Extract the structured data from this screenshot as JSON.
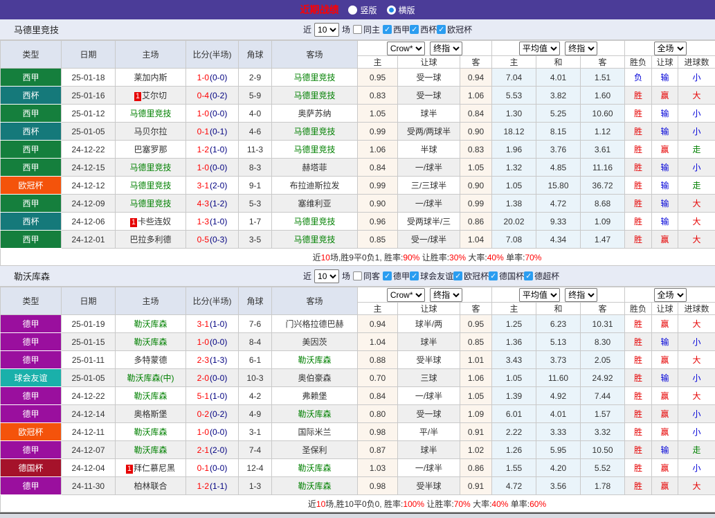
{
  "topbar": {
    "title": "近期战绩",
    "radio_vertical": "竖版",
    "radio_horizontal": "横版"
  },
  "table_header": {
    "col_type": "类型",
    "col_date": "日期",
    "col_home": "主场",
    "col_score": "比分(半场)",
    "col_corner": "角球",
    "col_away": "客场",
    "dd_crow": "Crow*",
    "dd_final1": "终指",
    "dd_avg": "平均值",
    "dd_final2": "终指",
    "dd_scope": "全场",
    "sub_home": "主",
    "sub_handicap": "让球",
    "sub_away": "客",
    "sub_avg_home": "主",
    "sub_draw": "和",
    "sub_avg_away": "客",
    "sub_result": "胜负",
    "sub_asian": "让球",
    "sub_goals": "进球数"
  },
  "palette": {
    "league_colors": {
      "西甲": "#157f3d",
      "西杯": "#15797a",
      "欧冠杯": "#f4530b",
      "德甲": "#9a0f9e",
      "球会友谊": "#1ab0aa",
      "德国杯": "#a5122a"
    },
    "value_colors": {
      "胜": "#e60000",
      "负": "#0000d8",
      "平": "#008000",
      "赢": "#e60000",
      "输": "#0000d8",
      "走": "#008000",
      "大": "#e60000",
      "小": "#0000d8"
    },
    "focus_team_color": "#008000",
    "rank_badge_bg": "#e60000"
  },
  "sections": [
    {
      "team": "马德里竞技",
      "filter": {
        "near_label": "近",
        "count": "10",
        "games_label": "场",
        "same_label": "同主",
        "same_checked": false,
        "leagues": [
          {
            "label": "西甲",
            "checked": true
          },
          {
            "label": "西杯",
            "checked": true
          },
          {
            "label": "欧冠杯",
            "checked": true
          }
        ]
      },
      "rows": [
        {
          "league": "西甲",
          "date": "25-01-18",
          "home": "莱加内斯",
          "home_focus": false,
          "home_rank": null,
          "score": "1-0",
          "half": "(0-0)",
          "corner": "2-9",
          "away": "马德里竞技",
          "away_focus": true,
          "odds_home": "0.95",
          "handicap": "受一球",
          "odds_away": "0.94",
          "avg_home": "7.04",
          "avg_draw": "4.01",
          "avg_away": "1.51",
          "result": "负",
          "asian": "输",
          "goals": "小"
        },
        {
          "league": "西杯",
          "date": "25-01-16",
          "home": "艾尔切",
          "home_focus": false,
          "home_rank": "1",
          "score": "0-4",
          "half": "(0-2)",
          "corner": "5-9",
          "away": "马德里竞技",
          "away_focus": true,
          "odds_home": "0.83",
          "handicap": "受一球",
          "odds_away": "1.06",
          "avg_home": "5.53",
          "avg_draw": "3.82",
          "avg_away": "1.60",
          "result": "胜",
          "asian": "赢",
          "goals": "大"
        },
        {
          "league": "西甲",
          "date": "25-01-12",
          "home": "马德里竞技",
          "home_focus": true,
          "home_rank": null,
          "score": "1-0",
          "half": "(0-0)",
          "corner": "4-0",
          "away": "奥萨苏纳",
          "away_focus": false,
          "odds_home": "1.05",
          "handicap": "球半",
          "odds_away": "0.84",
          "avg_home": "1.30",
          "avg_draw": "5.25",
          "avg_away": "10.60",
          "result": "胜",
          "asian": "输",
          "goals": "小"
        },
        {
          "league": "西杯",
          "date": "25-01-05",
          "home": "马贝尔拉",
          "home_focus": false,
          "home_rank": null,
          "score": "0-1",
          "half": "(0-1)",
          "corner": "4-6",
          "away": "马德里竞技",
          "away_focus": true,
          "odds_home": "0.99",
          "handicap": "受两/两球半",
          "odds_away": "0.90",
          "avg_home": "18.12",
          "avg_draw": "8.15",
          "avg_away": "1.12",
          "result": "胜",
          "asian": "输",
          "goals": "小"
        },
        {
          "league": "西甲",
          "date": "24-12-22",
          "home": "巴塞罗那",
          "home_focus": false,
          "home_rank": null,
          "score": "1-2",
          "half": "(1-0)",
          "corner": "11-3",
          "away": "马德里竞技",
          "away_focus": true,
          "odds_home": "1.06",
          "handicap": "半球",
          "odds_away": "0.83",
          "avg_home": "1.96",
          "avg_draw": "3.76",
          "avg_away": "3.61",
          "result": "胜",
          "asian": "赢",
          "goals": "走"
        },
        {
          "league": "西甲",
          "date": "24-12-15",
          "home": "马德里竞技",
          "home_focus": true,
          "home_rank": null,
          "score": "1-0",
          "half": "(0-0)",
          "corner": "8-3",
          "away": "赫塔菲",
          "away_focus": false,
          "odds_home": "0.84",
          "handicap": "一/球半",
          "odds_away": "1.05",
          "avg_home": "1.32",
          "avg_draw": "4.85",
          "avg_away": "11.16",
          "result": "胜",
          "asian": "输",
          "goals": "小"
        },
        {
          "league": "欧冠杯",
          "date": "24-12-12",
          "home": "马德里竞技",
          "home_focus": true,
          "home_rank": null,
          "score": "3-1",
          "half": "(2-0)",
          "corner": "9-1",
          "away": "布拉迪斯拉发",
          "away_focus": false,
          "odds_home": "0.99",
          "handicap": "三/三球半",
          "odds_away": "0.90",
          "avg_home": "1.05",
          "avg_draw": "15.80",
          "avg_away": "36.72",
          "result": "胜",
          "asian": "输",
          "goals": "走"
        },
        {
          "league": "西甲",
          "date": "24-12-09",
          "home": "马德里竞技",
          "home_focus": true,
          "home_rank": null,
          "score": "4-3",
          "half": "(1-2)",
          "corner": "5-3",
          "away": "塞维利亚",
          "away_focus": false,
          "odds_home": "0.90",
          "handicap": "一/球半",
          "odds_away": "0.99",
          "avg_home": "1.38",
          "avg_draw": "4.72",
          "avg_away": "8.68",
          "result": "胜",
          "asian": "输",
          "goals": "大"
        },
        {
          "league": "西杯",
          "date": "24-12-06",
          "home": "卡些连奴",
          "home_focus": false,
          "home_rank": "1",
          "score": "1-3",
          "half": "(1-0)",
          "corner": "1-7",
          "away": "马德里竞技",
          "away_focus": true,
          "odds_home": "0.96",
          "handicap": "受两球半/三",
          "odds_away": "0.86",
          "avg_home": "20.02",
          "avg_draw": "9.33",
          "avg_away": "1.09",
          "result": "胜",
          "asian": "输",
          "goals": "大"
        },
        {
          "league": "西甲",
          "date": "24-12-01",
          "home": "巴拉多利德",
          "home_focus": false,
          "home_rank": null,
          "score": "0-5",
          "half": "(0-3)",
          "corner": "3-5",
          "away": "马德里竞技",
          "away_focus": true,
          "odds_home": "0.85",
          "handicap": "受一/球半",
          "odds_away": "1.04",
          "avg_home": "7.08",
          "avg_draw": "4.34",
          "avg_away": "1.47",
          "result": "胜",
          "asian": "赢",
          "goals": "大"
        }
      ],
      "summary": [
        {
          "t": "近"
        },
        {
          "t": "10",
          "red": true
        },
        {
          "t": "场,胜9平0负1, 胜率:"
        },
        {
          "t": "90%",
          "red": true
        },
        {
          "t": " 让胜率:"
        },
        {
          "t": "30%",
          "red": true
        },
        {
          "t": " 大率:"
        },
        {
          "t": "40%",
          "red": true
        },
        {
          "t": " 单率:"
        },
        {
          "t": "70%",
          "red": true
        }
      ]
    },
    {
      "team": "勒沃库森",
      "filter": {
        "near_label": "近",
        "count": "10",
        "games_label": "场",
        "same_label": "同客",
        "same_checked": false,
        "leagues": [
          {
            "label": "德甲",
            "checked": true
          },
          {
            "label": "球会友谊",
            "checked": true
          },
          {
            "label": "欧冠杯",
            "checked": true
          },
          {
            "label": "德国杯",
            "checked": true
          },
          {
            "label": "德超杯",
            "checked": true
          }
        ]
      },
      "rows": [
        {
          "league": "德甲",
          "date": "25-01-19",
          "home": "勒沃库森",
          "home_focus": true,
          "home_rank": null,
          "score": "3-1",
          "half": "(1-0)",
          "corner": "7-6",
          "away": "门兴格拉德巴赫",
          "away_focus": false,
          "odds_home": "0.94",
          "handicap": "球半/两",
          "odds_away": "0.95",
          "avg_home": "1.25",
          "avg_draw": "6.23",
          "avg_away": "10.31",
          "result": "胜",
          "asian": "赢",
          "goals": "大"
        },
        {
          "league": "德甲",
          "date": "25-01-15",
          "home": "勒沃库森",
          "home_focus": true,
          "home_rank": null,
          "score": "1-0",
          "half": "(0-0)",
          "corner": "8-4",
          "away": "美因茨",
          "away_focus": false,
          "odds_home": "1.04",
          "handicap": "球半",
          "odds_away": "0.85",
          "avg_home": "1.36",
          "avg_draw": "5.13",
          "avg_away": "8.30",
          "result": "胜",
          "asian": "输",
          "goals": "小"
        },
        {
          "league": "德甲",
          "date": "25-01-11",
          "home": "多特蒙德",
          "home_focus": false,
          "home_rank": null,
          "score": "2-3",
          "half": "(1-3)",
          "corner": "6-1",
          "away": "勒沃库森",
          "away_focus": true,
          "odds_home": "0.88",
          "handicap": "受半球",
          "odds_away": "1.01",
          "avg_home": "3.43",
          "avg_draw": "3.73",
          "avg_away": "2.05",
          "result": "胜",
          "asian": "赢",
          "goals": "大"
        },
        {
          "league": "球会友谊",
          "date": "25-01-05",
          "home": "勒沃库森(中)",
          "home_focus": true,
          "home_rank": null,
          "score": "2-0",
          "half": "(0-0)",
          "corner": "10-3",
          "away": "奥伯豪森",
          "away_focus": false,
          "odds_home": "0.70",
          "handicap": "三球",
          "odds_away": "1.06",
          "avg_home": "1.05",
          "avg_draw": "11.60",
          "avg_away": "24.92",
          "result": "胜",
          "asian": "输",
          "goals": "小"
        },
        {
          "league": "德甲",
          "date": "24-12-22",
          "home": "勒沃库森",
          "home_focus": true,
          "home_rank": null,
          "score": "5-1",
          "half": "(1-0)",
          "corner": "4-2",
          "away": "弗赖堡",
          "away_focus": false,
          "odds_home": "0.84",
          "handicap": "一/球半",
          "odds_away": "1.05",
          "avg_home": "1.39",
          "avg_draw": "4.92",
          "avg_away": "7.44",
          "result": "胜",
          "asian": "赢",
          "goals": "大"
        },
        {
          "league": "德甲",
          "date": "24-12-14",
          "home": "奥格斯堡",
          "home_focus": false,
          "home_rank": null,
          "score": "0-2",
          "half": "(0-2)",
          "corner": "4-9",
          "away": "勒沃库森",
          "away_focus": true,
          "odds_home": "0.80",
          "handicap": "受一球",
          "odds_away": "1.09",
          "avg_home": "6.01",
          "avg_draw": "4.01",
          "avg_away": "1.57",
          "result": "胜",
          "asian": "赢",
          "goals": "小"
        },
        {
          "league": "欧冠杯",
          "date": "24-12-11",
          "home": "勒沃库森",
          "home_focus": true,
          "home_rank": null,
          "score": "1-0",
          "half": "(0-0)",
          "corner": "3-1",
          "away": "国际米兰",
          "away_focus": false,
          "odds_home": "0.98",
          "handicap": "平/半",
          "odds_away": "0.91",
          "avg_home": "2.22",
          "avg_draw": "3.33",
          "avg_away": "3.32",
          "result": "胜",
          "asian": "赢",
          "goals": "小"
        },
        {
          "league": "德甲",
          "date": "24-12-07",
          "home": "勒沃库森",
          "home_focus": true,
          "home_rank": null,
          "score": "2-1",
          "half": "(2-0)",
          "corner": "7-4",
          "away": "圣保利",
          "away_focus": false,
          "odds_home": "0.87",
          "handicap": "球半",
          "odds_away": "1.02",
          "avg_home": "1.26",
          "avg_draw": "5.95",
          "avg_away": "10.50",
          "result": "胜",
          "asian": "输",
          "goals": "走"
        },
        {
          "league": "德国杯",
          "date": "24-12-04",
          "home": "拜仁慕尼黑",
          "home_focus": false,
          "home_rank": "1",
          "score": "0-1",
          "half": "(0-0)",
          "corner": "12-4",
          "away": "勒沃库森",
          "away_focus": true,
          "odds_home": "1.03",
          "handicap": "一/球半",
          "odds_away": "0.86",
          "avg_home": "1.55",
          "avg_draw": "4.20",
          "avg_away": "5.52",
          "result": "胜",
          "asian": "赢",
          "goals": "小"
        },
        {
          "league": "德甲",
          "date": "24-11-30",
          "home": "柏林联合",
          "home_focus": false,
          "home_rank": null,
          "score": "1-2",
          "half": "(1-1)",
          "corner": "1-3",
          "away": "勒沃库森",
          "away_focus": true,
          "odds_home": "0.98",
          "handicap": "受半球",
          "odds_away": "0.91",
          "avg_home": "4.72",
          "avg_draw": "3.56",
          "avg_away": "1.78",
          "result": "胜",
          "asian": "赢",
          "goals": "大"
        }
      ],
      "summary": [
        {
          "t": "近"
        },
        {
          "t": "10",
          "red": true
        },
        {
          "t": "场,胜10平0负0, 胜率:"
        },
        {
          "t": "100%",
          "red": true
        },
        {
          "t": " 让胜率:"
        },
        {
          "t": "70%",
          "red": true
        },
        {
          "t": " 大率:"
        },
        {
          "t": "40%",
          "red": true
        },
        {
          "t": " 单率:"
        },
        {
          "t": "60%",
          "red": true
        }
      ]
    }
  ]
}
